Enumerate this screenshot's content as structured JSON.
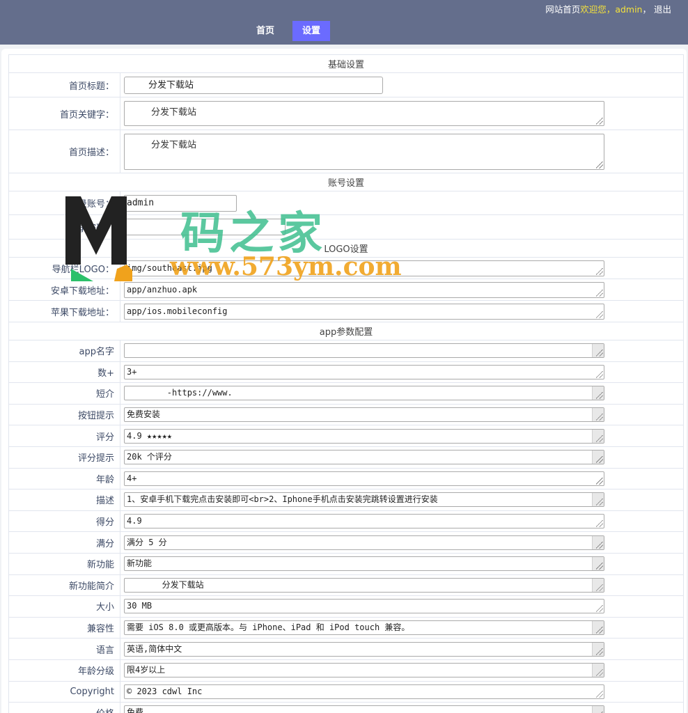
{
  "header": {
    "home_link": "网站首页",
    "welcome": "欢迎您，",
    "username": "admin",
    "sep": "，",
    "logout": "退出",
    "tabs": [
      {
        "label": "首页"
      },
      {
        "label": "设置"
      }
    ]
  },
  "sections": {
    "basic": "基础设置",
    "account": "账号设置",
    "logo": "LOGO设置",
    "app": "app参数配置"
  },
  "basic": {
    "title_label": "首页标题：",
    "title_value": "分发下载站",
    "keywords_label": "首页关键字：",
    "keywords_value": "分发下载站",
    "desc_label": "首页描述：",
    "desc_value": "分发下载站"
  },
  "account": {
    "user_label": "登录账号：",
    "user_value": "admin",
    "pass_label": "登录密码："
  },
  "logo": {
    "nav_logo_label": "导航栏LOGO：",
    "nav_logo_value": "img/southeast.jpg",
    "android_label": "安卓下载地址：",
    "android_value": "app/anzhuo.apk",
    "ios_label": "苹果下载地址：",
    "ios_value": "app/ios.mobileconfig"
  },
  "app": {
    "rows": [
      {
        "label": "app名字",
        "value": "",
        "scroll": true
      },
      {
        "label": "数+",
        "value": "3+",
        "scroll": false
      },
      {
        "label": "短介",
        "value": "        -https://www.",
        "scroll": true
      },
      {
        "label": "按钮提示",
        "value": "免费安装",
        "scroll": true
      },
      {
        "label": "评分",
        "value": "4.9 ★★★★★",
        "scroll": true
      },
      {
        "label": "评分提示",
        "value": "20k 个评分",
        "scroll": true
      },
      {
        "label": "年龄",
        "value": "4+",
        "scroll": false
      },
      {
        "label": "描述",
        "value": "1、安卓手机下载完点击安装即可<br>2、Iphone手机点击安装完跳转设置进行安装",
        "scroll": true
      },
      {
        "label": "得分",
        "value": "4.9",
        "scroll": false
      },
      {
        "label": "满分",
        "value": "满分 5 分",
        "scroll": true
      },
      {
        "label": "新功能",
        "value": "新功能",
        "scroll": true
      },
      {
        "label": "新功能简介",
        "value": "       分发下载站",
        "scroll": true
      },
      {
        "label": "大小",
        "value": "30 MB",
        "scroll": false
      },
      {
        "label": "兼容性",
        "value": "需要 iOS 8.0 或更高版本。与 iPhone、iPad 和 iPod touch 兼容。",
        "scroll": true
      },
      {
        "label": "语言",
        "value": "英语,简体中文",
        "scroll": true
      },
      {
        "label": "年龄分级",
        "value": "限4岁以上",
        "scroll": true
      },
      {
        "label": "Copyright",
        "value": "© 2023 cdwl Inc",
        "scroll": false
      },
      {
        "label": "价格",
        "value": "免费",
        "scroll": true
      }
    ]
  },
  "watermark": {
    "text": "码之家",
    "url": "www.573ym.com"
  },
  "colors": {
    "topbar": "#646e8c",
    "active_tab": "#6b6bff",
    "highlight": "#f5e23b"
  }
}
